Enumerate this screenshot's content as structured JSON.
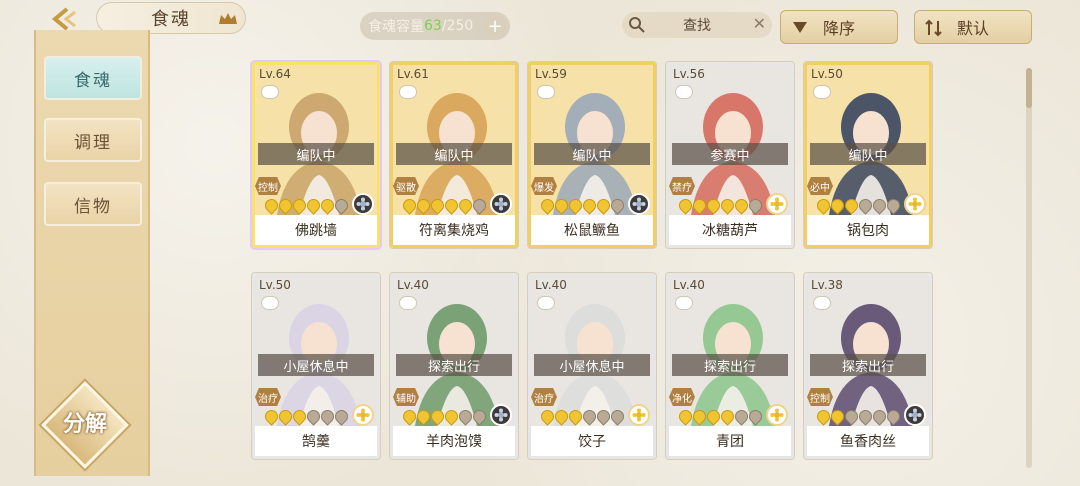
{
  "header": {
    "title": "食魂",
    "capacity_label": "食魂容量",
    "capacity_current": "63",
    "capacity_max": "/250",
    "capacity_add": "+",
    "search_placeholder": "查找",
    "sort_label": "降序",
    "default_label": "默认"
  },
  "sidebar": {
    "tabs": [
      {
        "label": "食魂",
        "active": true
      },
      {
        "label": "调理",
        "active": false
      },
      {
        "label": "信物",
        "active": false
      }
    ],
    "decompose_label": "分解"
  },
  "cards": [
    {
      "level": "Lv.64",
      "status": "编队中",
      "role": "控制",
      "name": "佛跳墙",
      "stars": 5,
      "frame": "rainbow",
      "art_color": "#c9a36a",
      "rank_gold": false
    },
    {
      "level": "Lv.61",
      "status": "编队中",
      "role": "驱散",
      "name": "符离集烧鸡",
      "stars": 5,
      "frame": "gold",
      "art_color": "#d7a256",
      "rank_gold": false
    },
    {
      "level": "Lv.59",
      "status": "编队中",
      "role": "爆发",
      "name": "松鼠鳜鱼",
      "stars": 5,
      "frame": "gold",
      "art_color": "#9aa8b9",
      "rank_gold": false
    },
    {
      "level": "Lv.56",
      "status": "参赛中",
      "role": "禁疗",
      "name": "冰糖葫芦",
      "stars": 5,
      "frame": "silver",
      "art_color": "#d66a5c",
      "rank_gold": true
    },
    {
      "level": "Lv.50",
      "status": "编队中",
      "role": "必中",
      "name": "锅包肉",
      "stars": 3,
      "frame": "gold",
      "art_color": "#3a4660",
      "rank_gold": true
    },
    {
      "level": "Lv.50",
      "status": "小屋休息中",
      "role": "治疗",
      "name": "鹄羹",
      "stars": 3,
      "frame": "silver",
      "art_color": "#d9d1e4",
      "rank_gold": true
    },
    {
      "level": "Lv.40",
      "status": "探索出行",
      "role": "辅助",
      "name": "羊肉泡馍",
      "stars": 4,
      "frame": "silver",
      "art_color": "#6f9a6a",
      "rank_gold": false
    },
    {
      "level": "Lv.40",
      "status": "小屋休息中",
      "role": "治疗",
      "name": "饺子",
      "stars": 3,
      "frame": "silver",
      "art_color": "#dcdcdc",
      "rank_gold": true
    },
    {
      "level": "Lv.40",
      "status": "探索出行",
      "role": "净化",
      "name": "青团",
      "stars": 4,
      "frame": "silver",
      "art_color": "#8cc48a",
      "rank_gold": true
    },
    {
      "level": "Lv.38",
      "status": "探索出行",
      "role": "控制",
      "name": "鱼香肉丝",
      "stars": 2,
      "frame": "silver",
      "art_color": "#5c4a6e",
      "rank_gold": false
    }
  ],
  "colors": {
    "accent_gold": "#f0c531",
    "active_tab": "#bfe4e0",
    "capacity_current": "#7bd04f"
  }
}
